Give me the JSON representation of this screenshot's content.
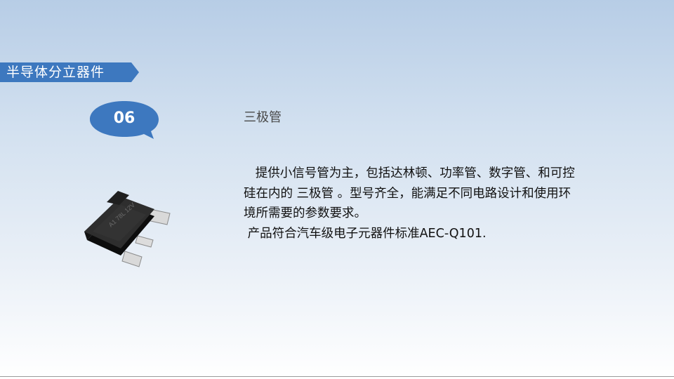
{
  "slide": {
    "title": "半导体分立器件",
    "badge_number": "06",
    "section_heading": "三极管",
    "description_lines": [
      "   提供小信号管为主，包括达林顿、功率管、数字管、和可控硅在内的 三极管 。型号齐全，能满足不同电路设计和使用环境所需要的参数要求。",
      " 产品符合汽车级电子元器件标准AEC-Q101."
    ],
    "product_marking": "A1 78L 12V"
  },
  "colors": {
    "ribbon": "#3d78bf",
    "badge": "#3d78bf",
    "text": "#111111"
  },
  "icons": {
    "product_image": "sot-89-transistor-package"
  }
}
